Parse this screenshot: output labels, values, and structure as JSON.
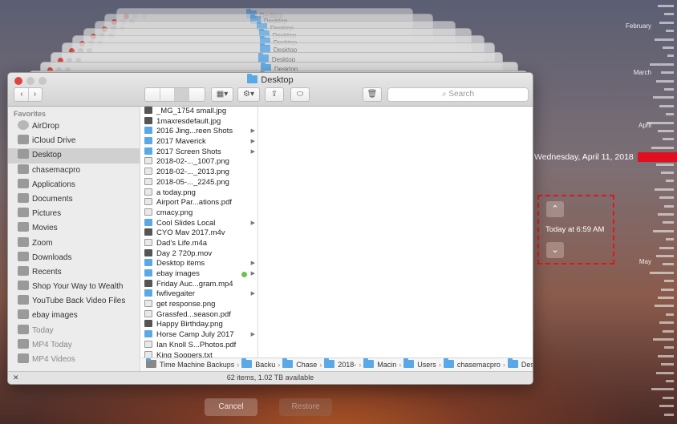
{
  "stack_title": "Desktop",
  "window": {
    "title": "Desktop",
    "back": "‹",
    "forward": "›",
    "search_placeholder": "Search"
  },
  "sidebar": {
    "header": "Favorites",
    "items": [
      {
        "label": "AirDrop",
        "icon": "airdrop-icon",
        "dim": false
      },
      {
        "label": "iCloud Drive",
        "icon": "cloud-icon",
        "dim": false
      },
      {
        "label": "Desktop",
        "icon": "desktop-icon",
        "dim": false,
        "selected": true
      },
      {
        "label": "chasemacpro",
        "icon": "home-icon",
        "dim": false
      },
      {
        "label": "Applications",
        "icon": "applications-icon",
        "dim": false
      },
      {
        "label": "Documents",
        "icon": "documents-icon",
        "dim": false
      },
      {
        "label": "Pictures",
        "icon": "pictures-icon",
        "dim": false
      },
      {
        "label": "Movies",
        "icon": "movies-icon",
        "dim": false
      },
      {
        "label": "Zoom",
        "icon": "folder-icon",
        "dim": false
      },
      {
        "label": "Downloads",
        "icon": "downloads-icon",
        "dim": false
      },
      {
        "label": "Recents",
        "icon": "recents-icon",
        "dim": false
      },
      {
        "label": "Shop Your Way to Wealth",
        "icon": "folder-icon",
        "dim": false
      },
      {
        "label": "YouTube Back Video Files",
        "icon": "folder-icon",
        "dim": false
      },
      {
        "label": "ebay images",
        "icon": "folder-icon",
        "dim": false
      },
      {
        "label": "Today",
        "icon": "smart-folder-icon",
        "dim": true
      },
      {
        "label": "MP4 Today",
        "icon": "smart-folder-icon",
        "dim": true
      },
      {
        "label": "MP4 Videos",
        "icon": "smart-folder-icon",
        "dim": true
      }
    ]
  },
  "files": [
    {
      "name": "_MG_1754 small.jpg",
      "kind": "img",
      "arrow": false
    },
    {
      "name": "1maxresdefault.jpg",
      "kind": "img",
      "arrow": false
    },
    {
      "name": "2016 Jing...reen Shots",
      "kind": "folder",
      "arrow": true
    },
    {
      "name": "2017  Maverick",
      "kind": "folder",
      "arrow": true
    },
    {
      "name": "2017 Screen Shots",
      "kind": "folder",
      "arrow": true
    },
    {
      "name": "2018-02-..._1007.png",
      "kind": "doc",
      "arrow": false
    },
    {
      "name": "2018-02-..._2013.png",
      "kind": "doc",
      "arrow": false
    },
    {
      "name": "2018-05-..._2245.png",
      "kind": "doc",
      "arrow": false
    },
    {
      "name": "a today.png",
      "kind": "doc",
      "arrow": false
    },
    {
      "name": "Airport Par...ations.pdf",
      "kind": "doc",
      "arrow": false
    },
    {
      "name": "cmacy.png",
      "kind": "doc",
      "arrow": false
    },
    {
      "name": "Cool Slides Local",
      "kind": "folder",
      "arrow": true
    },
    {
      "name": "CYO Mav 2017.m4v",
      "kind": "img",
      "arrow": false
    },
    {
      "name": "Dad's Life.m4a",
      "kind": "doc",
      "arrow": false
    },
    {
      "name": "Day 2 720p.mov",
      "kind": "img",
      "arrow": false
    },
    {
      "name": "Desktop items",
      "kind": "folder",
      "arrow": true
    },
    {
      "name": "ebay images",
      "kind": "folder",
      "arrow": true,
      "tag": true
    },
    {
      "name": "Friday Auc...gram.mp4",
      "kind": "img",
      "arrow": false
    },
    {
      "name": "fwfivegaiter",
      "kind": "folder",
      "arrow": true
    },
    {
      "name": "get response.png",
      "kind": "doc",
      "arrow": false
    },
    {
      "name": "Grassfed...season.pdf",
      "kind": "doc",
      "arrow": false
    },
    {
      "name": "Happy Birthday.png",
      "kind": "img",
      "arrow": false
    },
    {
      "name": "Horse Camp July 2017",
      "kind": "folder",
      "arrow": true
    },
    {
      "name": "Ian Knoll S...Photos.pdf",
      "kind": "doc",
      "arrow": false
    },
    {
      "name": "King Soopers.txt",
      "kind": "doc",
      "arrow": false
    }
  ],
  "path": [
    "Time Machine Backups",
    "Backu",
    "Chase",
    "2018-",
    "Macin",
    "Users",
    "chasemacpro",
    "Desktop"
  ],
  "status": "62 items, 1.02 TB available",
  "timeline": {
    "months": [
      "February",
      "March",
      "April",
      "May"
    ],
    "date": "Wednesday, April 11, 2018",
    "time": "Today at 6:59 AM",
    "up": "⌃",
    "down": "⌄"
  },
  "buttons": {
    "cancel": "Cancel",
    "restore": "Restore"
  }
}
